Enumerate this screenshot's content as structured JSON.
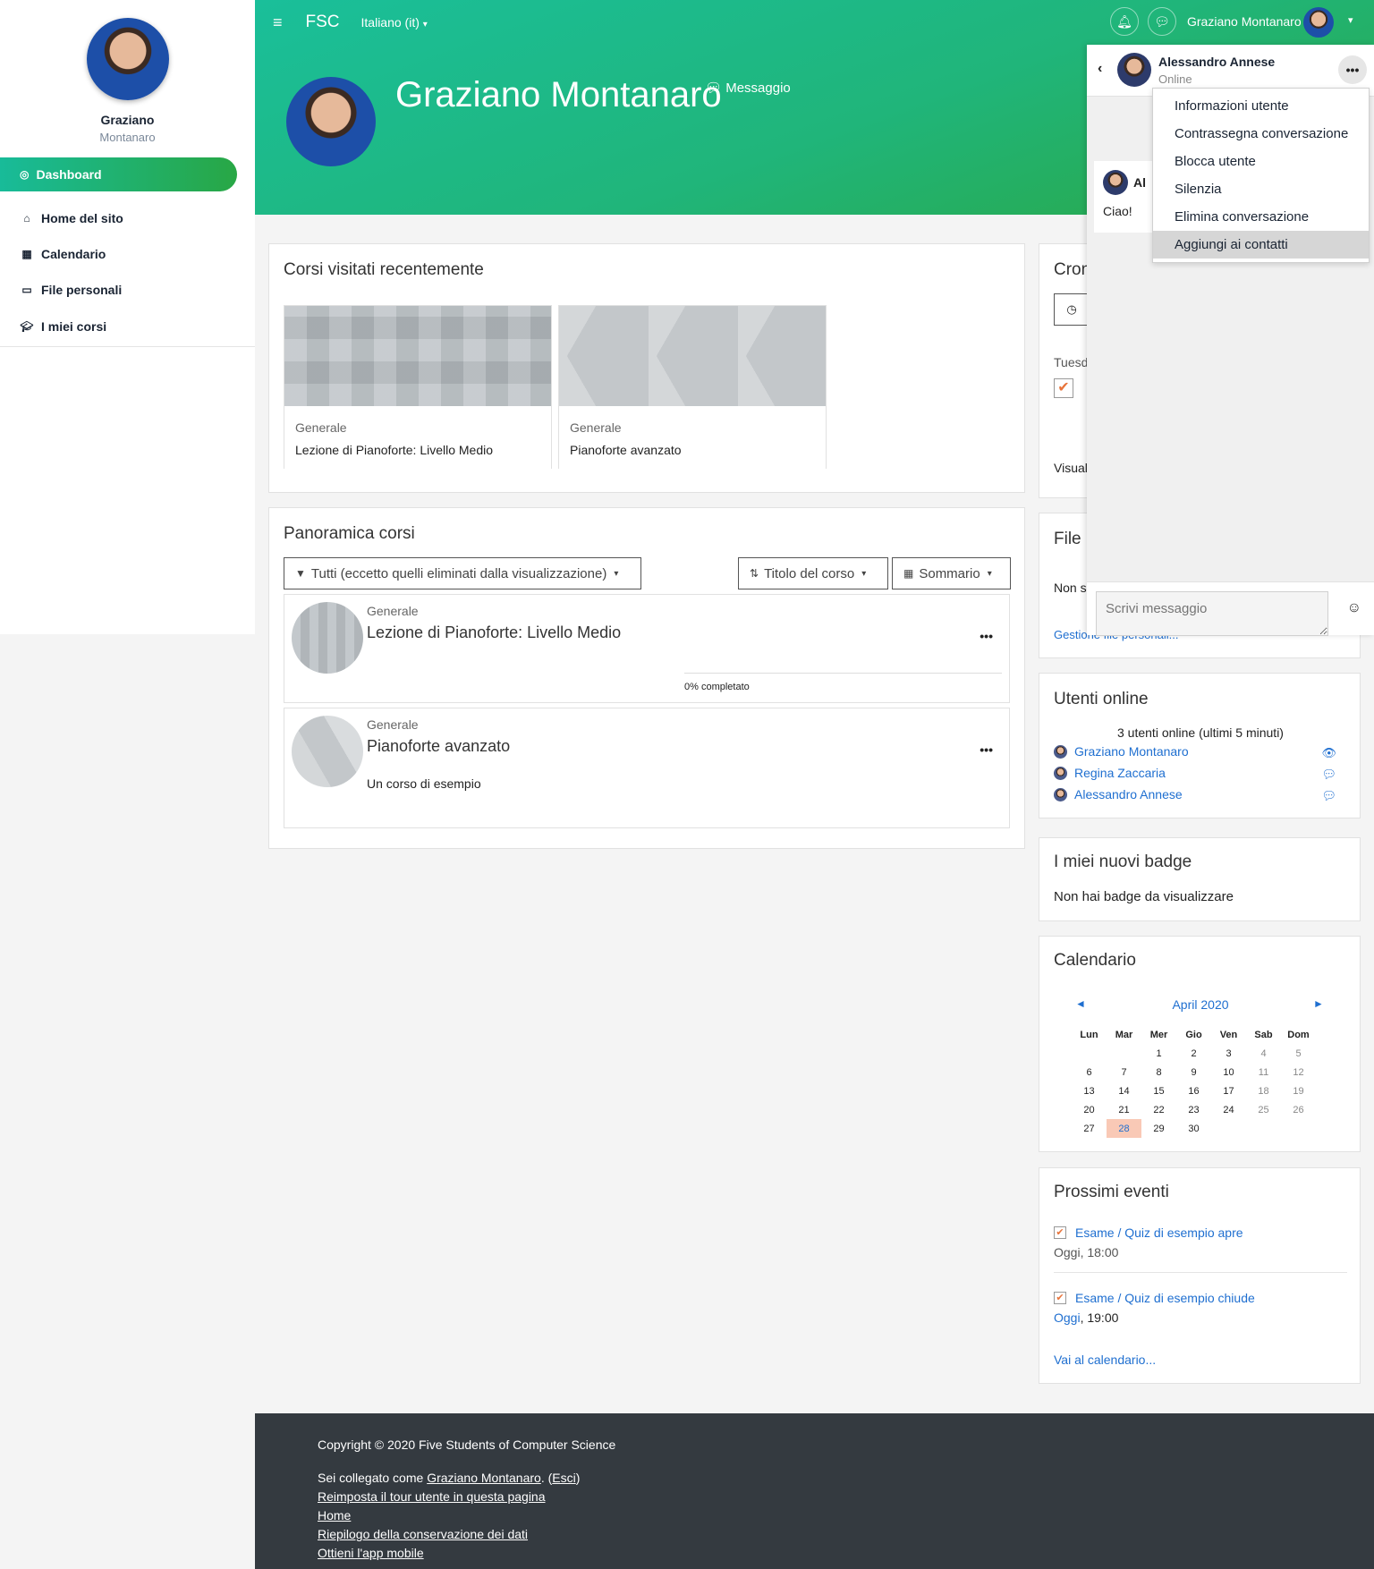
{
  "sidebar": {
    "first_name": "Graziano",
    "last_name": "Montanaro",
    "items": [
      {
        "label": "Dashboard",
        "icon": "dashboard-icon"
      },
      {
        "label": "Home del sito",
        "icon": "home-icon"
      },
      {
        "label": "Calendario",
        "icon": "calendar-icon"
      },
      {
        "label": "File personali",
        "icon": "file-icon"
      },
      {
        "label": "I miei corsi",
        "icon": "graduation-cap-icon"
      }
    ]
  },
  "header": {
    "brand": "FSC",
    "language": "Italiano (it)",
    "user_name": "Graziano Montanaro",
    "profile_name": "Graziano Montanaro",
    "message_label": "Messaggio"
  },
  "recent_courses": {
    "title": "Corsi visitati recentemente",
    "items": [
      {
        "category": "Generale",
        "name": "Lezione di Pianoforte: Livello Medio"
      },
      {
        "category": "Generale",
        "name": "Pianoforte avanzato"
      }
    ]
  },
  "overview": {
    "title": "Panoramica corsi",
    "filter_label": "Tutti (eccetto quelli eliminati dalla visualizzazione)",
    "sort_label": "Titolo del corso",
    "view_label": "Sommario",
    "courses": [
      {
        "category": "Generale",
        "name": "Lezione di Pianoforte: Livello Medio",
        "progress_text": "0% completato",
        "progress": 0
      },
      {
        "category": "Generale",
        "name": "Pianoforte avanzato",
        "summary": "Un corso di esempio"
      }
    ]
  },
  "timeline": {
    "title_partial": "Cron",
    "date_partial": "Tuesd",
    "link_partial": "Visual"
  },
  "private_files": {
    "title_partial": "File p",
    "text_partial": "Non s",
    "link_partial": "Gestione file personali..."
  },
  "online_users": {
    "title": "Utenti online",
    "summary": "3 utenti online (ultimi 5 minuti)",
    "users": [
      {
        "name": "Graziano Montanaro"
      },
      {
        "name": "Regina Zaccaria"
      },
      {
        "name": "Alessandro Annese"
      }
    ]
  },
  "badges": {
    "title": "I miei nuovi badge",
    "text": "Non hai badge da visualizzare"
  },
  "calendar": {
    "title": "Calendario",
    "month": "April 2020",
    "prev": "◄",
    "next": "►",
    "weekdays": [
      "Lun",
      "Mar",
      "Mer",
      "Gio",
      "Ven",
      "Sab",
      "Dom"
    ],
    "weeks": [
      [
        "",
        "",
        "1",
        "2",
        "3",
        "4",
        "5"
      ],
      [
        "6",
        "7",
        "8",
        "9",
        "10",
        "11",
        "12"
      ],
      [
        "13",
        "14",
        "15",
        "16",
        "17",
        "18",
        "19"
      ],
      [
        "20",
        "21",
        "22",
        "23",
        "24",
        "25",
        "26"
      ],
      [
        "27",
        "28",
        "29",
        "30",
        "",
        "",
        ""
      ]
    ],
    "today": "28"
  },
  "events": {
    "title": "Prossimi eventi",
    "items": [
      {
        "name": "Esame / Quiz di esempio apre",
        "time_link": "",
        "time": "Oggi, 18:00"
      },
      {
        "name": "Esame / Quiz di esempio chiude",
        "time_link": "Oggi",
        "time": ", 19:00"
      }
    ],
    "goto": "Vai al calendario..."
  },
  "footer": {
    "copyright": "Copyright © 2020 Five Students of Computer Science",
    "logged_prefix": "Sei collegato come ",
    "logged_user": "Graziano Montanaro",
    "logged_mid": ". (",
    "logout": "Esci",
    "logged_suffix": ")",
    "links": [
      "Reimposta il tour utente in questa pagina",
      "Home",
      "Riepilogo della conservazione dei dati",
      "Ottieni l'app mobile"
    ]
  },
  "drawer": {
    "contact_name": "Alessandro Annese",
    "status": "Online",
    "bubble_name": "Al",
    "bubble_text": "Ciao!",
    "menu": [
      "Informazioni utente",
      "Contrassegna conversazione",
      "Blocca utente",
      "Silenzia",
      "Elimina conversazione",
      "Aggiungi ai contatti"
    ],
    "placeholder": "Scrivi messaggio"
  },
  "colors": {
    "accent": "#1f6fd0",
    "header_start": "#1abf9a",
    "header_end": "#2aa745",
    "footer": "#343a40",
    "today": "#f9c9b6"
  }
}
